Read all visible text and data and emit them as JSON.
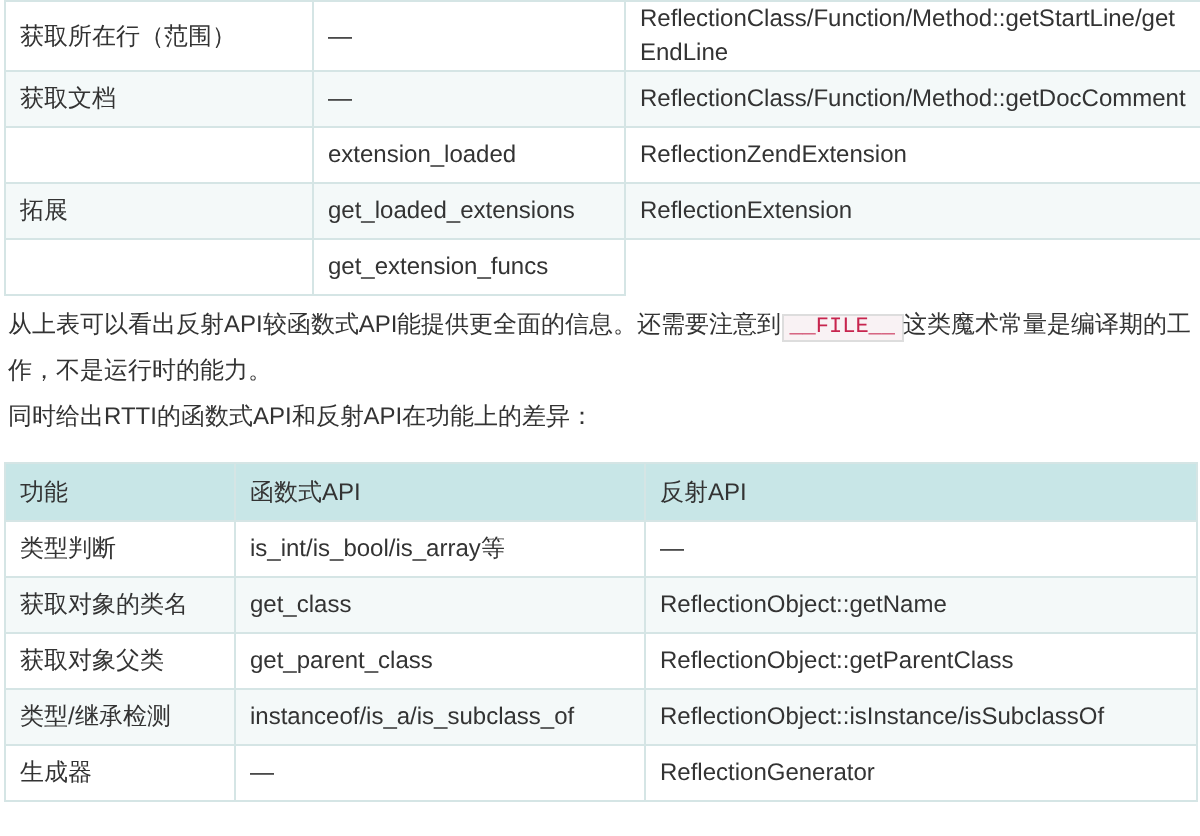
{
  "table_1": {
    "rows": [
      {
        "cells": [
          "获取所在行（范围）",
          "—",
          "ReflectionClass/Function/Method::getStartLine/getEndLine"
        ]
      },
      {
        "cells": [
          "获取文档",
          "—",
          "ReflectionClass/Function/Method::getDocComment"
        ]
      },
      {
        "cells": [
          "",
          "extension_loaded",
          "ReflectionZendExtension"
        ]
      },
      {
        "cells": [
          "拓展",
          "get_loaded_extensions",
          "ReflectionExtension"
        ]
      },
      {
        "cells": [
          "",
          "get_extension_funcs"
        ]
      }
    ]
  },
  "paragraphs": [
    {
      "parts": [
        {
          "kind": "text",
          "text": "从上表可以看出反射API较函数式API能提供更全面的信息。还需要注意到"
        },
        {
          "kind": "code",
          "text": "__FILE__"
        },
        {
          "kind": "text",
          "text": "这类魔术常量是编译期的工作，不是运行时的能力。"
        }
      ]
    },
    {
      "parts": [
        {
          "kind": "text",
          "text": "同时给出RTTI的函数式API和反射API在功能上的差异："
        }
      ]
    }
  ],
  "table_2": {
    "columns": [
      "功能",
      "函数式API",
      "反射API"
    ],
    "rows": [
      {
        "cells": [
          "类型判断",
          "is_int/is_bool/is_array等",
          "—"
        ]
      },
      {
        "cells": [
          "获取对象的类名",
          "get_class",
          "ReflectionObject::getName"
        ]
      },
      {
        "cells": [
          "获取对象父类",
          "get_parent_class",
          "ReflectionObject::getParentClass"
        ]
      },
      {
        "cells": [
          "类型/继承检测",
          "instanceof/is_a/is_subclass_of",
          "ReflectionObject::isInstance/isSubclassOf"
        ]
      },
      {
        "cells": [
          "生成器",
          "—",
          "ReflectionGenerator"
        ]
      }
    ]
  }
}
